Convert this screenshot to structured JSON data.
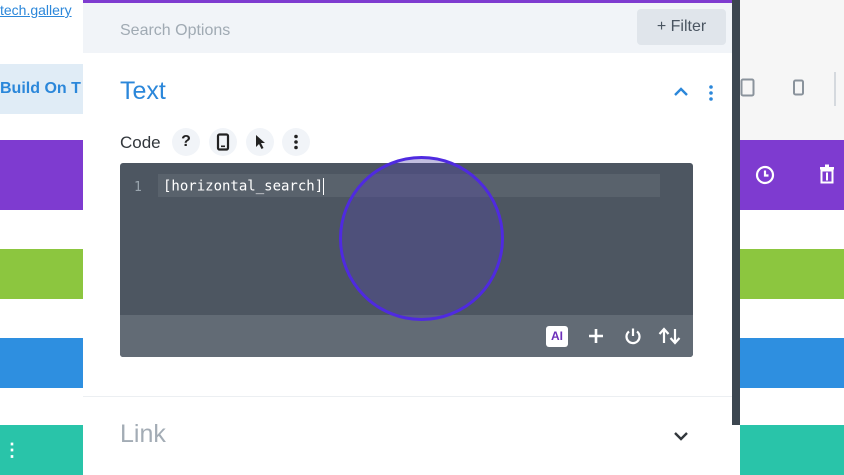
{
  "background": {
    "link_text": "tech.gallery",
    "button_label": "Build On T",
    "menu_icon": "vertical-dots-icon",
    "right_icons": [
      "tablet-icon",
      "phone-icon",
      "clock-icon",
      "trash-icon"
    ]
  },
  "modal": {
    "search": {
      "placeholder": "Search Options",
      "filter_label": "+ Filter"
    },
    "text_section": {
      "title": "Text",
      "toggle_icon": "chevron-up-icon",
      "more_icon": "kebab-icon",
      "code_label": "Code",
      "code_tools": [
        {
          "icon": "help-icon",
          "glyph": "?"
        },
        {
          "icon": "mobile-icon"
        },
        {
          "icon": "pointer-icon"
        },
        {
          "icon": "kebab-icon"
        }
      ],
      "editor": {
        "line_number": "1",
        "code": "[horizontal_search]",
        "ai_badge": "AI",
        "footer_icons": [
          "add-icon",
          "power-icon",
          "sort-icon"
        ]
      }
    },
    "link_section": {
      "title": "Link",
      "toggle_icon": "chevron-down-icon"
    }
  },
  "colors": {
    "accent_purple": "#7e3bd0",
    "link_blue": "#2b87da",
    "editor_bg": "#4d5661",
    "touch_ring": "#4f2ae0"
  }
}
